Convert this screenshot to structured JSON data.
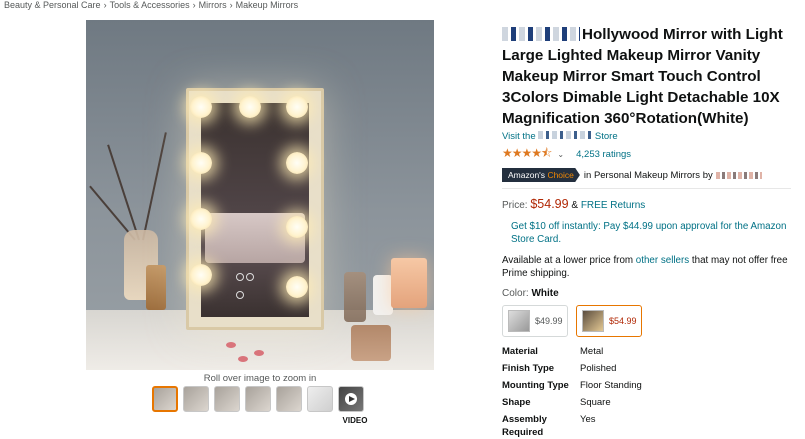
{
  "breadcrumb": [
    "Beauty & Personal Care",
    "Tools & Accessories",
    "Mirrors",
    "Makeup Mirrors"
  ],
  "gallery": {
    "zoom_hint": "Roll over image to zoom in",
    "video_label": "VIDEO",
    "thumbnail_count": 8
  },
  "product": {
    "title": "Hollywood Mirror with Light Large Lighted Makeup Mirror Vanity Makeup Mirror Smart Touch Control 3Colors Dimable Light Detachable 10X Magnification 360°Rotation(White)",
    "visit_prefix": "Visit the",
    "visit_suffix": "Store",
    "rating_stars": "★★★★⯪",
    "ratings_count": "4,253 ratings",
    "badge_prefix": "Amazon's",
    "badge_choice": "Choice",
    "badge_context": "in Personal Makeup Mirrors by",
    "price_label": "Price:",
    "price": "$54.99",
    "free_returns_sep": "&",
    "free_returns": "FREE Returns",
    "promo": "Get $10 off instantly: Pay $44.99 upon approval for the Amazon Store Card.",
    "availability_prefix": "Available at a lower price from",
    "availability_link": "other sellers",
    "availability_suffix": "that may not offer free Prime shipping.",
    "color_label": "Color:",
    "color_value": "White",
    "swatches": [
      {
        "price": "$49.99",
        "selected": false
      },
      {
        "price": "$54.99",
        "selected": true
      }
    ],
    "specs": [
      {
        "key": "Material",
        "value": "Metal"
      },
      {
        "key": "Finish Type",
        "value": "Polished"
      },
      {
        "key": "Mounting Type",
        "value": "Floor Standing"
      },
      {
        "key": "Shape",
        "value": "Square"
      },
      {
        "key": "Assembly Required",
        "value": "Yes"
      }
    ]
  },
  "colors": {
    "link": "#007185",
    "price": "#b12704",
    "star": "#de7921",
    "badge_bg": "#232f3e",
    "badge_accent": "#f08804",
    "selected_border": "#e77600"
  }
}
